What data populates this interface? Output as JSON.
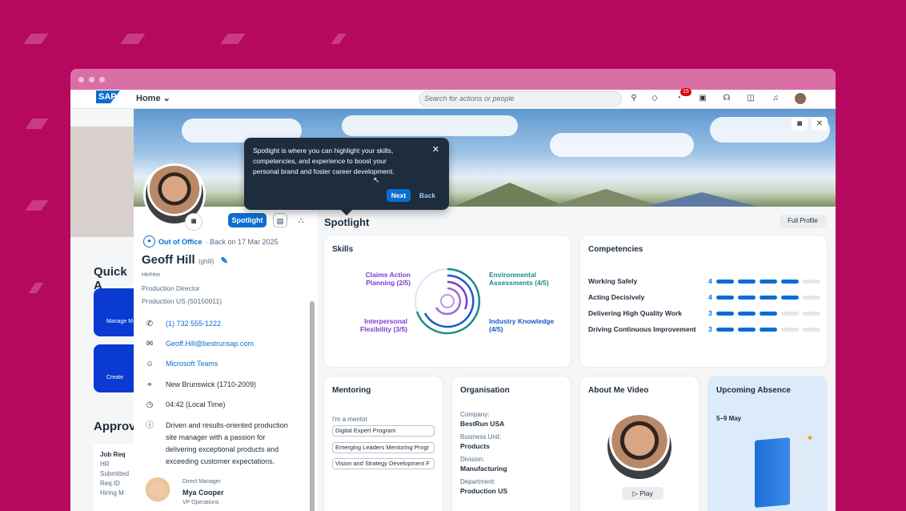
{
  "shell": {
    "home_label": "Home",
    "search_placeholder": "Search for actions or people",
    "notification_badge": "15"
  },
  "background_page": {
    "quick_actions_label": "Quick A",
    "tile1_label": "Manage M",
    "tile2_label": "Create",
    "approvals_label": "Approv",
    "job_card": {
      "title": "Job Req",
      "lines": [
        "HR",
        "Submitted",
        "Req ID",
        "Hiring M"
      ]
    }
  },
  "profile": {
    "spotlight_chip": "Spotlight",
    "status": "Out of Office",
    "status_detail": "· Back on 17 Mar 2025",
    "name": "Geoff Hill",
    "username": "(ghill)",
    "pronouns": "He/Him",
    "title": "Production Director",
    "org": "Production US (50150011)",
    "phone": "(1) 732 555-1222",
    "email": "Geoff.Hill@bestrunsap.com",
    "teams": "Microsoft Teams",
    "location": "New Brunswick (1710-2009)",
    "local_time": "04:42 (Local Time)",
    "bio": "Driven and results-oriented production site manager with a passion for delivering exceptional products and exceeding customer expectations.",
    "manager_label": "Direct Manager",
    "manager_name": "Mya Cooper",
    "manager_title": "VP Operations"
  },
  "spotlight": {
    "title": "Spotlight",
    "full_profile": "Full Profile"
  },
  "skills": {
    "title": "Skills",
    "items": [
      {
        "label": "Claims Action Planning (2/5)",
        "color": "#7b3bd1"
      },
      {
        "label": "Environmental Assessments (4/5)",
        "color": "#178c8a"
      },
      {
        "label": "Interpersonal Flexibility (3/5)",
        "color": "#7b3bd1"
      },
      {
        "label": "Industry Knowledge (4/5)",
        "color": "#1a5ac8"
      }
    ]
  },
  "competencies": {
    "title": "Competencies",
    "items": [
      {
        "label": "Working Safely",
        "level": 4
      },
      {
        "label": "Acting Decisively",
        "level": 4
      },
      {
        "label": "Delivering High Quality Work",
        "level": 3
      },
      {
        "label": "Driving Continuous Improvement",
        "level": 3
      }
    ],
    "max": 5,
    "filled_color": "#0a6ed1",
    "empty_color": "#e5e8ea"
  },
  "mentoring": {
    "title": "Mentoring",
    "subtitle": "I'm a mentor",
    "chips": [
      "Digital Expert Program",
      "Emerging Leaders Mentoring Progr",
      "Vision and Strategy Development F"
    ]
  },
  "organisation": {
    "title": "Organisation",
    "company_label": "Company:",
    "company": "BestRun USA",
    "bu_label": "Business Unit:",
    "bu": "Products",
    "division_label": "Division:",
    "division": "Manufacturing",
    "dept_label": "Department:",
    "dept": "Production US"
  },
  "about": {
    "title": "About Me Video",
    "play": "Play"
  },
  "absence": {
    "title": "Upcoming Absence",
    "dates": "5–9 May"
  },
  "tooltip": {
    "text": "Spotlight is where you can highlight your skills, competencies, and experience to boost your personal brand and foster career development.",
    "next": "Next",
    "back": "Back"
  }
}
